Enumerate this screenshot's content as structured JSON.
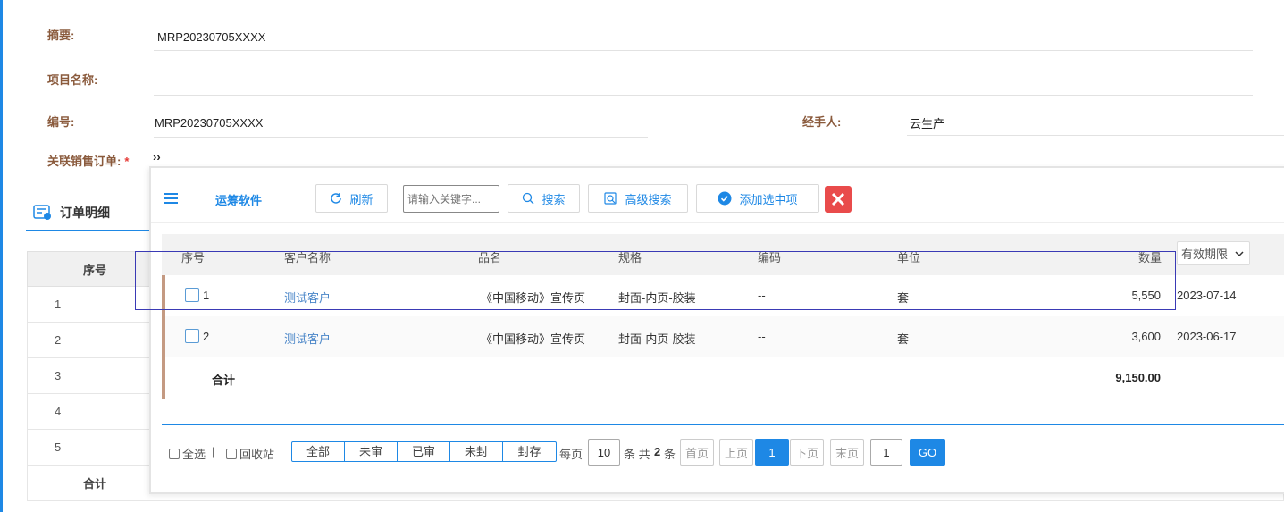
{
  "form": {
    "summary_label": "摘要:",
    "summary_value": "MRP20230705XXXX",
    "project_label": "项目名称:",
    "project_value": "",
    "code_label": "编号:",
    "code_value": "MRP20230705XXXX",
    "handler_label": "经手人:",
    "handler_value": "云生产",
    "related_order_label": "关联销售订单:",
    "required_mark": "*",
    "related_order_toggle": "››"
  },
  "detail": {
    "tab_label": "订单明细",
    "header_no": "序号",
    "rows": [
      "1",
      "2",
      "3",
      "4",
      "5"
    ],
    "total_label": "合计"
  },
  "popup": {
    "brand": "运筹软件",
    "refresh": "刷新",
    "search_placeholder": "请输入关键字...",
    "search": "搜索",
    "advanced_search": "高级搜索",
    "add_selected": "添加选中项",
    "columns": {
      "no": "序号",
      "customer": "客户名称",
      "product": "品名",
      "spec": "规格",
      "code": "编码",
      "unit": "单位",
      "qty": "数量",
      "expiry": "有效期限"
    },
    "rows": [
      {
        "no": "1",
        "customer": "测试客户",
        "product": "《中国移动》宣传页",
        "spec": "封面-内页-胶装",
        "code": "--",
        "unit": "套",
        "qty": "5,550",
        "expiry": "2023-07-14"
      },
      {
        "no": "2",
        "customer": "测试客户",
        "product": "《中国移动》宣传页",
        "spec": "封面-内页-胶装",
        "code": "--",
        "unit": "套",
        "qty": "3,600",
        "expiry": "2023-06-17"
      }
    ],
    "total_label": "合计",
    "total_qty": "9,150.00",
    "footer": {
      "select_all": "全选",
      "separator": "|",
      "recycle": "回收站",
      "filters": [
        "全部",
        "未审",
        "已审",
        "未封",
        "封存"
      ],
      "per_page_label": "每页",
      "per_page": "10",
      "total_prefix": "条 共",
      "total_count": "2",
      "total_suffix": "条",
      "first": "首页",
      "prev": "上页",
      "current": "1",
      "next": "下页",
      "last": "末页",
      "goto_value": "1",
      "go": "GO"
    }
  },
  "colors": {
    "accent": "#1e88e5",
    "label": "#8a5a3c",
    "link": "#4a86c8",
    "close": "#e94b4b",
    "highlight_border": "#3a3ab5"
  }
}
